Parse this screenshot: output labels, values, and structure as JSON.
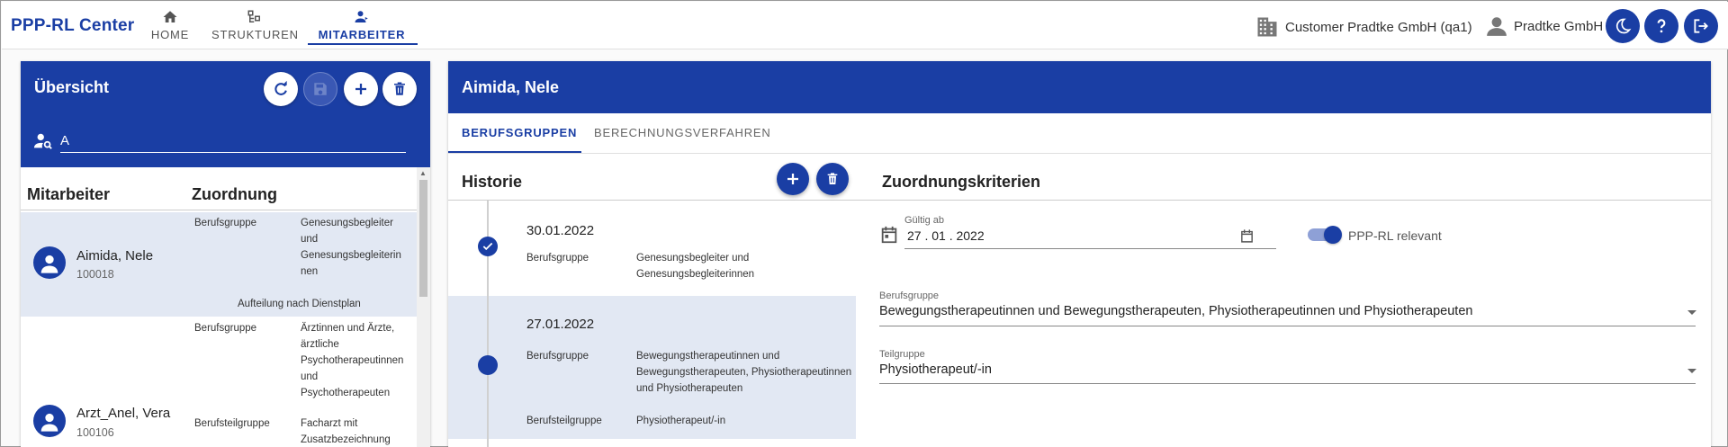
{
  "app": {
    "brand": "PPP-RL Center"
  },
  "nav": [
    {
      "label": "HOME",
      "icon": "home-icon",
      "active": false
    },
    {
      "label": "STRUKTUREN",
      "icon": "structure-icon",
      "active": false
    },
    {
      "label": "MITARBEITER",
      "icon": "person-manage-icon",
      "active": true
    }
  ],
  "header": {
    "customer": "Customer Pradtke GmbH (qa1)",
    "user": "Pradtke GmbH",
    "actions": [
      "theme-toggle-icon",
      "help-icon",
      "logout-icon"
    ]
  },
  "overview": {
    "title": "Übersicht",
    "search_value": "A",
    "col_employee": "Mitarbeiter",
    "col_assignment": "Zuordnung",
    "employees": [
      {
        "name": "Aimida, Nele",
        "id": "100018",
        "selected": true,
        "rows": [
          {
            "type": "Berufsgruppe",
            "value_lines": [
              "Genesungsbegleiter",
              "und",
              "Genesungsbegleiterin",
              "nen"
            ]
          }
        ],
        "note": "Aufteilung nach Dienstplan"
      },
      {
        "name": "Arzt_Anel, Vera",
        "id": "100106",
        "selected": false,
        "rows": [
          {
            "type": "Berufsgruppe",
            "value_lines": [
              "Ärztinnen und Ärzte,",
              "ärztliche",
              "Psychotherapeutinnen",
              "und",
              "Psychotherapeuten"
            ]
          },
          {
            "type": "Berufsteilgruppe",
            "value_lines": [
              "Facharzt mit",
              "Zusatzbezeichnung"
            ]
          }
        ]
      }
    ]
  },
  "detail": {
    "title": "Aimida, Nele",
    "tabs": [
      "BERUFSGRUPPEN",
      "BERECHNUNGSVERFAHREN"
    ],
    "history_title": "Historie",
    "history": [
      {
        "date": "30.01.2022",
        "checked": true,
        "selected": false,
        "rows": [
          {
            "type": "Berufsgruppe",
            "value_lines": [
              "Genesungsbegleiter und",
              "Genesungsbegleiterinnen"
            ]
          }
        ]
      },
      {
        "date": "27.01.2022",
        "checked": false,
        "selected": true,
        "rows": [
          {
            "type": "Berufsgruppe",
            "value_lines": [
              "Bewegungstherapeutinnen und",
              "Bewegungstherapeuten, Physiotherapeutinnen",
              "und Physiotherapeuten"
            ]
          },
          {
            "type": "Berufsteilgruppe",
            "value_lines": [
              "Physiotherapeut/-in"
            ]
          }
        ]
      }
    ],
    "criteria_title": "Zuordnungskriterien",
    "valid_from_label": "Gültig ab",
    "valid_from_value": "27 . 01 . 2022",
    "relevant_label": "PPP-RL relevant",
    "relevant_on": true,
    "group_label": "Berufsgruppe",
    "group_value": "Bewegungstherapeutinnen und Bewegungstherapeuten, Physiotherapeutinnen und Physiotherapeuten",
    "subgroup_label": "Teilgruppe",
    "subgroup_value": "Physiotherapeut/-in"
  },
  "colors": {
    "primary": "#1a3ea4",
    "selected_row": "#e2e8f3"
  }
}
